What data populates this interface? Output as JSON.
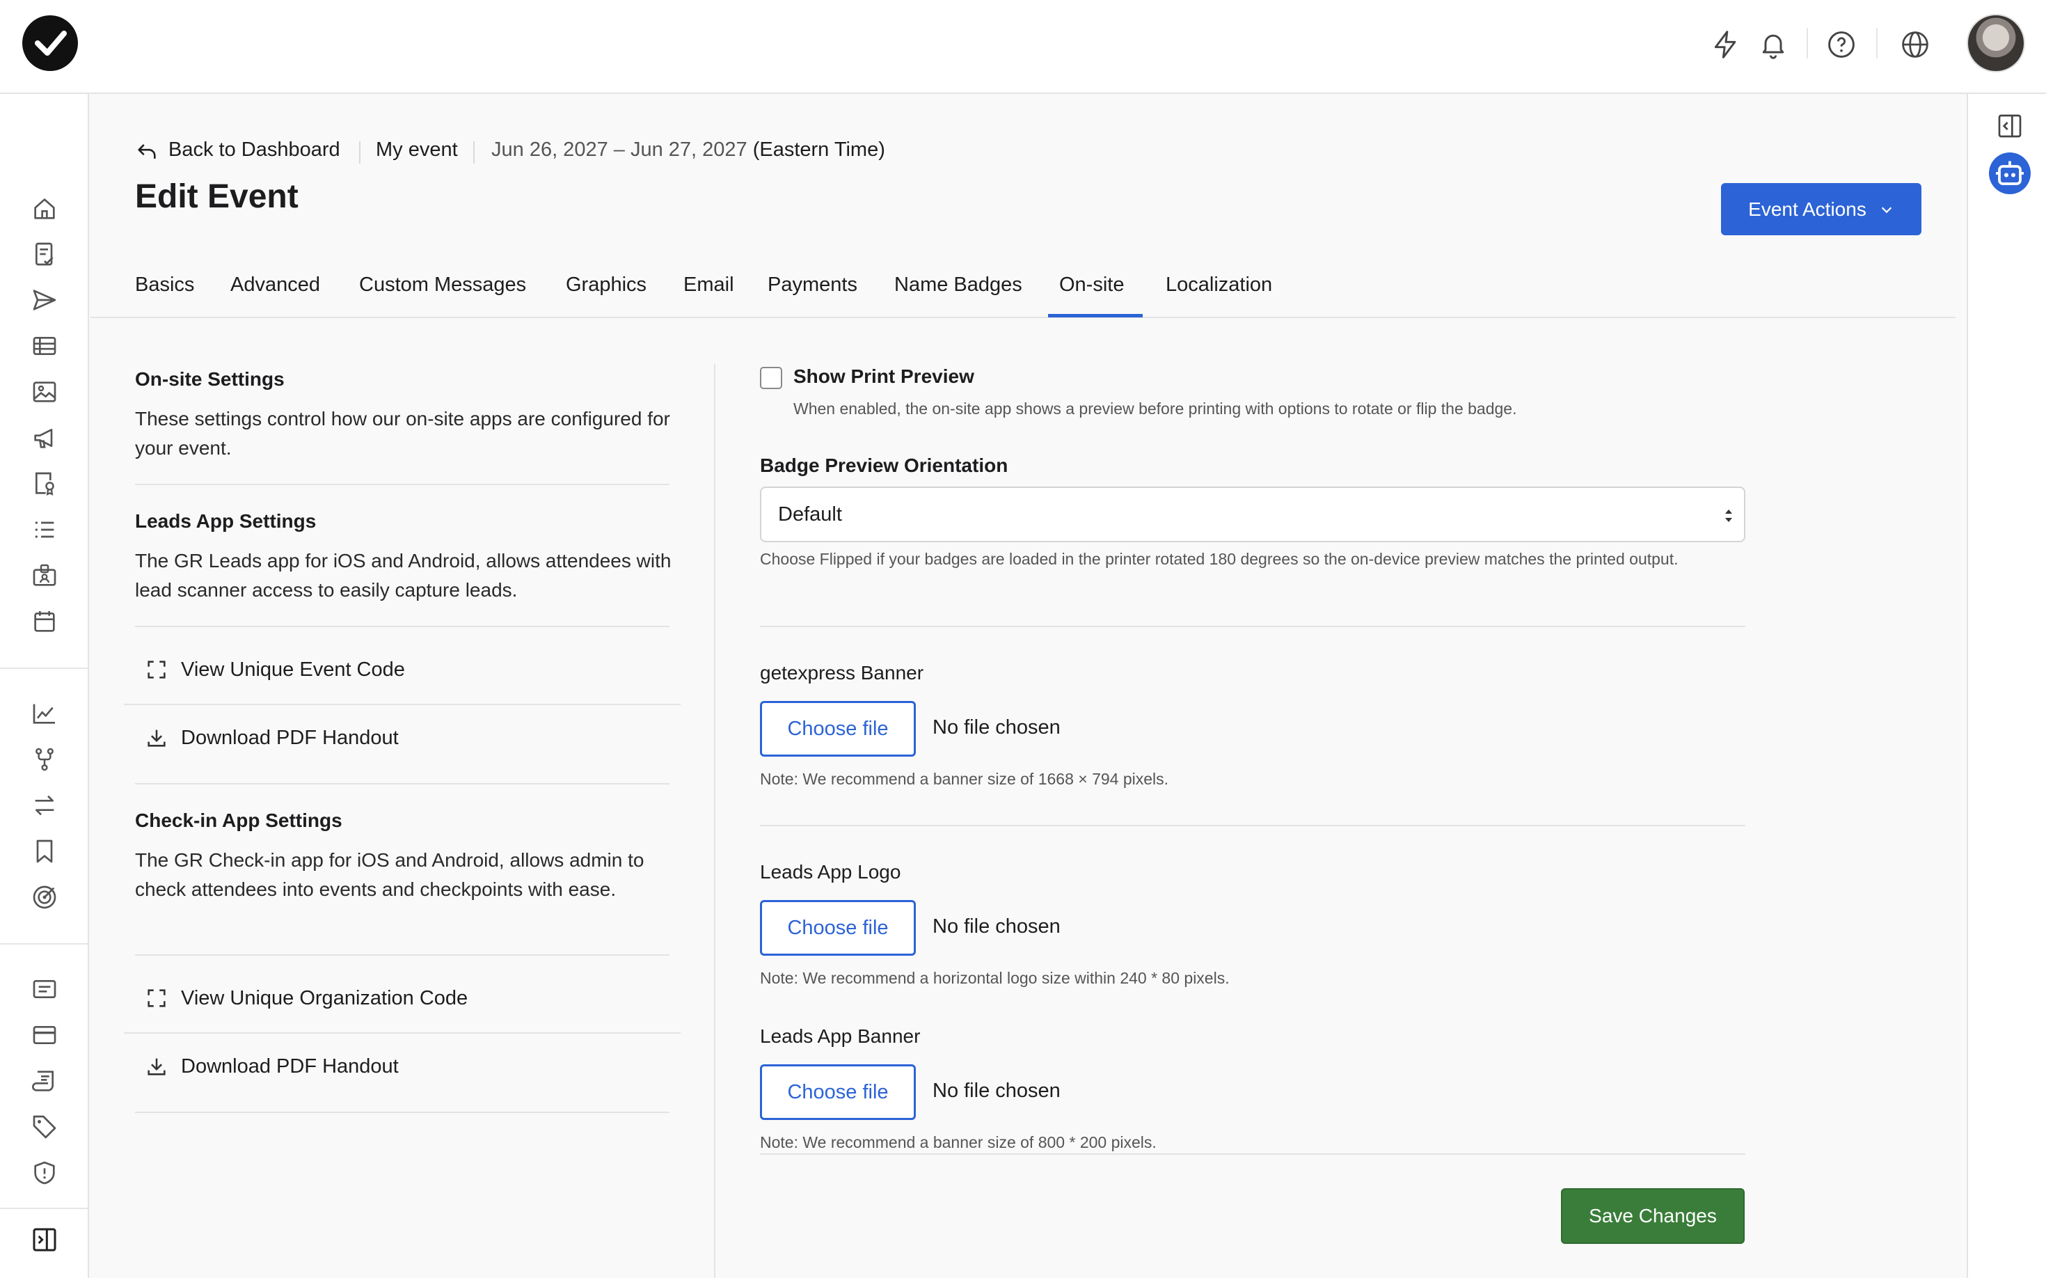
{
  "header": {
    "icons": [
      "lightning-icon",
      "bell-icon",
      "help-icon",
      "globe-icon",
      "avatar"
    ]
  },
  "breadcrumb": {
    "back": "Back to Dashboard",
    "event": "My event",
    "dates": "Jun 26, 2027 – Jun 27, 2027",
    "timezone": "(Eastern Time)"
  },
  "page": {
    "title": "Edit Event",
    "actions_label": "Event Actions"
  },
  "tabs": [
    {
      "label": "Basics"
    },
    {
      "label": "Advanced"
    },
    {
      "label": "Custom Messages"
    },
    {
      "label": "Graphics"
    },
    {
      "label": "Email"
    },
    {
      "label": "Payments"
    },
    {
      "label": "Name Badges"
    },
    {
      "label": "On-site",
      "active": true
    },
    {
      "label": "Localization"
    }
  ],
  "left": {
    "onsite_title": "On-site Settings",
    "onsite_body": "These settings control how our on-site apps are configured for your event.",
    "leads_title": "Leads App Settings",
    "leads_body": "The GR Leads app for iOS and Android, allows attendees with lead scanner access to easily capture leads.",
    "leads_link1": "View Unique Event Code",
    "leads_link2": "Download PDF Handout",
    "checkin_title": "Check-in App Settings",
    "checkin_body": "The GR Check-in app for iOS and Android, allows admin to check attendees into events and checkpoints with ease.",
    "checkin_link1": "View Unique Organization Code",
    "checkin_link2": "Download PDF Handout"
  },
  "right": {
    "print_preview_label": "Show Print Preview",
    "print_preview_checked": false,
    "print_preview_help": "When enabled, the on-site app shows a preview before printing with options to rotate or flip the badge.",
    "orientation_label": "Badge Preview Orientation",
    "orientation_value": "Default",
    "orientation_help": "Choose Flipped if your badges are loaded in the printer rotated 180 degrees so the on-device preview matches the printed output.",
    "banner_label": "getexpress Banner",
    "banner_note": "Note: We recommend a banner size of 1668 × 794 pixels.",
    "logo_label": "Leads App Logo",
    "logo_note": "Note: We recommend a horizontal logo size within 240 * 80 pixels.",
    "leads_banner_label": "Leads App Banner",
    "leads_banner_note": "Note: We recommend a banner size of 800 * 200 pixels.",
    "choose_file": "Choose file",
    "no_file": "No file chosen",
    "save_label": "Save Changes"
  },
  "colors": {
    "accent": "#2c63d6",
    "save": "#3a7d3a"
  }
}
